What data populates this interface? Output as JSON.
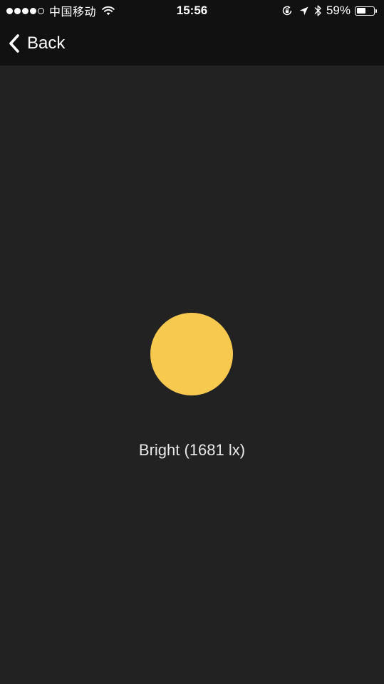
{
  "status_bar": {
    "carrier": "中国移动",
    "signal_bars_filled": 4,
    "signal_bars_total": 5,
    "time": "15:56",
    "battery_percent": "59%",
    "battery_level": 0.59,
    "icons": [
      "wifi-icon",
      "rotation-lock-icon",
      "location-arrow-icon",
      "bluetooth-icon",
      "battery-icon"
    ]
  },
  "nav": {
    "back_label": "Back",
    "back_icon": "chevron-left-icon"
  },
  "main": {
    "indicator_color": "#F7C94F",
    "light_label": "Bright (1681 lx)"
  },
  "colors": {
    "background": "#222222",
    "bar_background": "#111111",
    "text": "#FFFFFF"
  }
}
